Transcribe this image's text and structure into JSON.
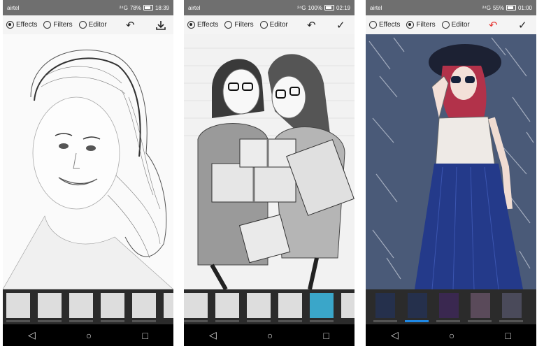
{
  "phones": [
    {
      "status": {
        "carrier": "airtel",
        "signal": "²⁴G",
        "battery": "78%",
        "time": "18:39"
      },
      "options": [
        {
          "label": "Effects",
          "selected": true
        },
        {
          "label": "Filters",
          "selected": false
        },
        {
          "label": "Editor",
          "selected": false
        }
      ],
      "undo_icon": "undo-icon",
      "action_icon": "download-icon",
      "filter_style": "pencil-sketch-grayscale"
    },
    {
      "status": {
        "carrier": "airtel",
        "signal": "²⁴G",
        "battery": "100%",
        "time": "02:19"
      },
      "options": [
        {
          "label": "Effects",
          "selected": true
        },
        {
          "label": "Filters",
          "selected": false
        },
        {
          "label": "Editor",
          "selected": false
        }
      ],
      "undo_icon": "undo-icon",
      "action_icon": "checkmark-icon",
      "filter_style": "pencil-sketch-grayscale"
    },
    {
      "status": {
        "carrier": "airtel",
        "signal": "²⁴G",
        "battery": "55%",
        "time": "01:00"
      },
      "options": [
        {
          "label": "Effects",
          "selected": false
        },
        {
          "label": "Filters",
          "selected": true
        },
        {
          "label": "Editor",
          "selected": false
        }
      ],
      "undo_icon": "undo-icon",
      "action_icon": "checkmark-icon",
      "filter_style": "colored-sketch",
      "selected_thumbnail": 2
    }
  ],
  "colors": {
    "statusbar": "#6f6f6f",
    "toolbar": "#f4f4f4",
    "thumbbar": "#2b2b2b",
    "navbar": "#000000",
    "accent_selected": "#1e88e5",
    "undo_active": "#e53935"
  },
  "nav_icons": [
    "back-icon",
    "home-icon",
    "recents-icon"
  ]
}
